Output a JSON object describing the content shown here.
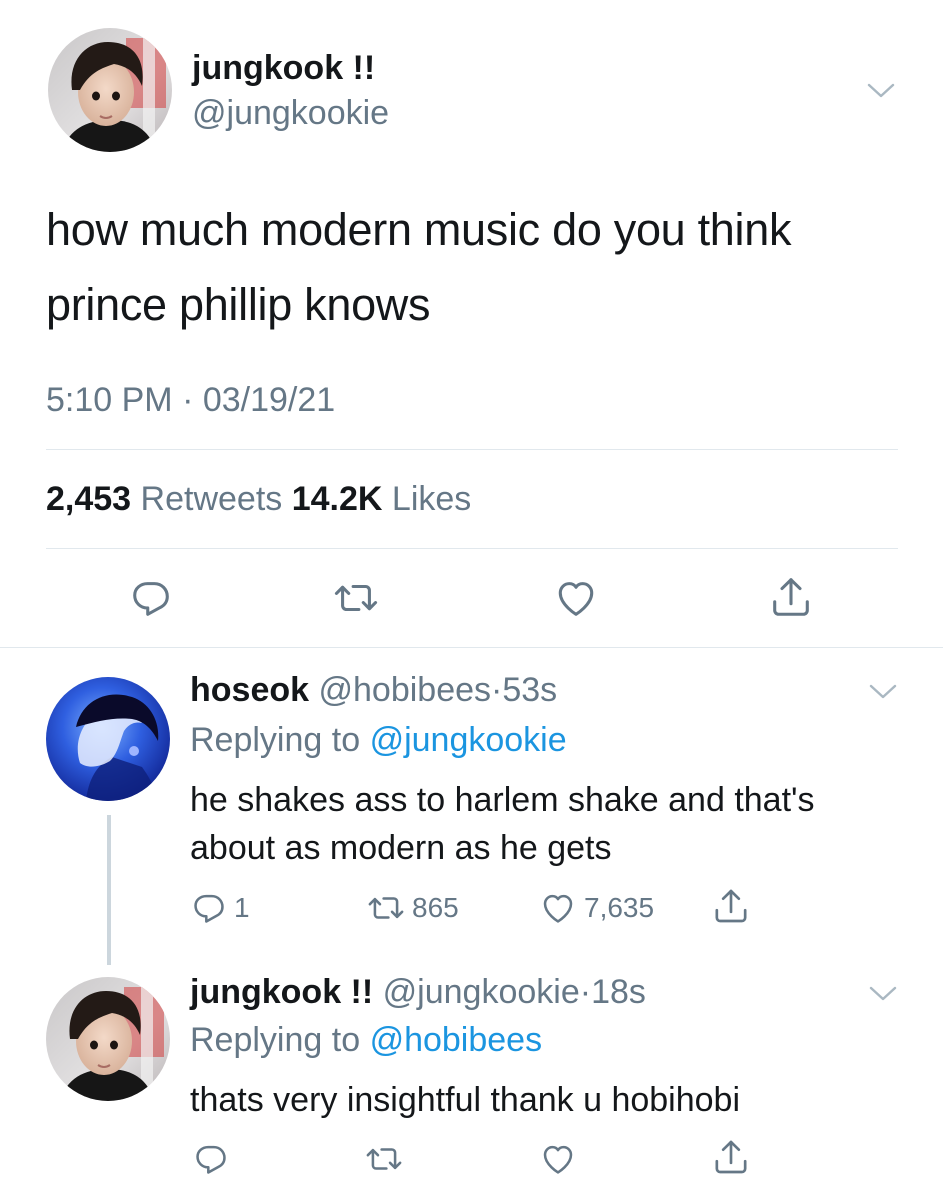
{
  "main_tweet": {
    "display_name": "jungkook !!",
    "handle": "@jungkookie",
    "text": "how much modern music do you think prince phillip knows",
    "timestamp": "5:10 PM · 03/19/21",
    "retweets_count": "2,453",
    "retweets_label": "Retweets",
    "likes_count": "14.2K",
    "likes_label": "Likes"
  },
  "replies": [
    {
      "display_name": "hoseok",
      "handle": "@hobibees",
      "dot": "·",
      "ago": "53s",
      "replying_prefix": "Replying to",
      "replying_to": "@jungkookie",
      "text": "he shakes ass to harlem shake and that's about as modern as he gets",
      "reply_count": "1",
      "retweet_count": "865",
      "like_count": "7,635"
    },
    {
      "display_name": "jungkook !!",
      "handle": "@jungkookie",
      "dot": "·",
      "ago": "18s",
      "replying_prefix": "Replying to",
      "replying_to": "@hobibees",
      "text": "thats very insightful thank u hobihobi"
    }
  ],
  "icons": [
    "chevron-down-icon",
    "reply-icon",
    "retweet-icon",
    "like-icon",
    "share-icon"
  ],
  "colors": {
    "text": "#14171a",
    "secondary": "#657786",
    "link": "#1b95e0",
    "divider": "#e1e8ed",
    "thread_line": "#ccd6dd"
  }
}
